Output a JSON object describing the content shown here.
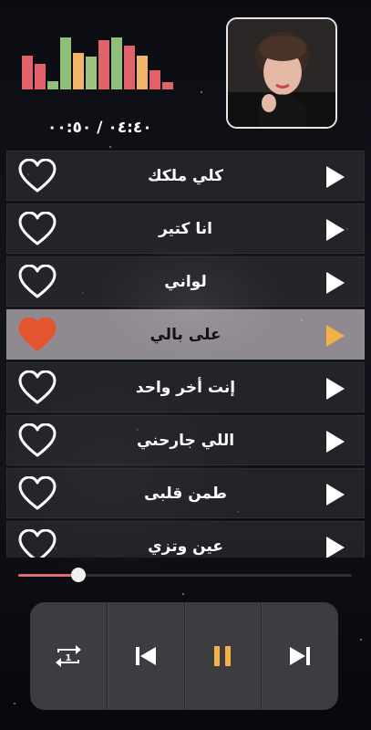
{
  "player": {
    "time": "٠٤:٤٠ / ٠٠:٥٠",
    "progress_fraction": 0.18
  },
  "equalizer": {
    "levels": [
      0.64,
      0.48,
      0.16,
      0.98,
      0.69,
      0.62,
      0.93,
      0.98,
      0.83,
      0.64,
      0.36,
      0.14
    ],
    "colors": [
      "#e2626a",
      "#e2626a",
      "#8fbf7a",
      "#8fbf7a",
      "#f2b46b",
      "#9ec27f",
      "#e2626a",
      "#8fbf7a",
      "#e2626a",
      "#f2b46b",
      "#e2626a",
      "#e2626a"
    ]
  },
  "tracks": [
    {
      "title": "كلي ملكك",
      "liked": false,
      "active": false
    },
    {
      "title": "انا كتير",
      "liked": false,
      "active": false
    },
    {
      "title": "لواني",
      "liked": false,
      "active": false
    },
    {
      "title": "على بالي",
      "liked": true,
      "active": true
    },
    {
      "title": "إنت أخر واحد",
      "liked": false,
      "active": false
    },
    {
      "title": "اللي جارحني",
      "liked": false,
      "active": false
    },
    {
      "title": "طمن قلبى",
      "liked": false,
      "active": false
    },
    {
      "title": "عين وتزي",
      "liked": false,
      "active": false
    }
  ],
  "controls": {
    "repeat_badge": "1",
    "repeat_icon": "repeat-one-icon",
    "previous_icon": "skip-previous-icon",
    "pause_icon": "pause-icon",
    "next_icon": "skip-next-icon"
  },
  "colors": {
    "accent": "#f2b248",
    "heart_liked": "#e2552f",
    "progress": "#e06b72",
    "active_row": "#bdb9be"
  }
}
